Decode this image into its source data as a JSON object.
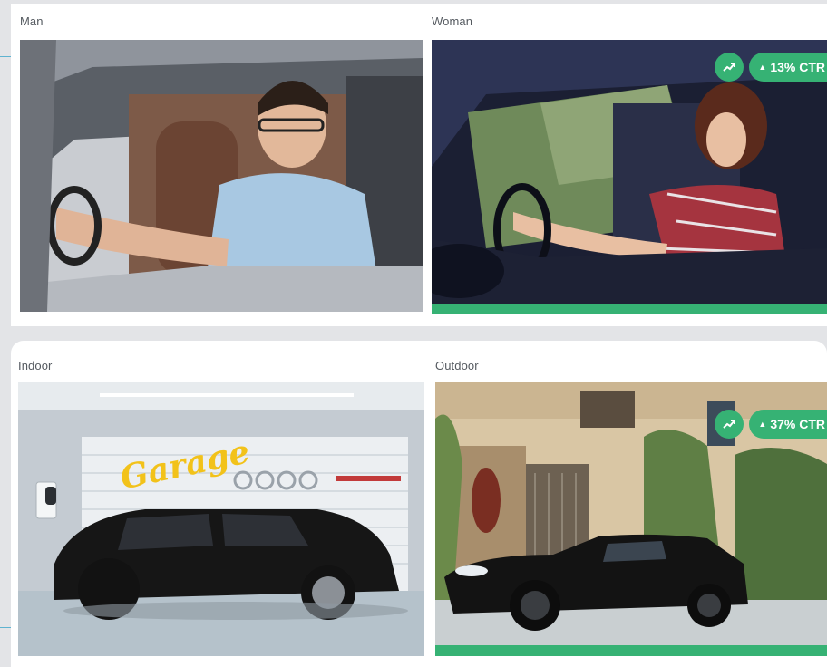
{
  "test_gender": {
    "variants": [
      {
        "label": "Man",
        "winner": false
      },
      {
        "label": "Woman",
        "winner": true,
        "ctr_text": "13% CTR"
      }
    ]
  },
  "test_location": {
    "variants": [
      {
        "label": "Indoor",
        "winner": false,
        "sign_text": "Garage"
      },
      {
        "label": "Outdoor",
        "winner": true,
        "ctr_text": "37% CTR"
      }
    ]
  },
  "colors": {
    "accent_green": "#36b274",
    "background": "#e3e4e7"
  },
  "icons": {
    "trend": "trending-up-icon",
    "up_arrow": "up-triangle-icon"
  }
}
